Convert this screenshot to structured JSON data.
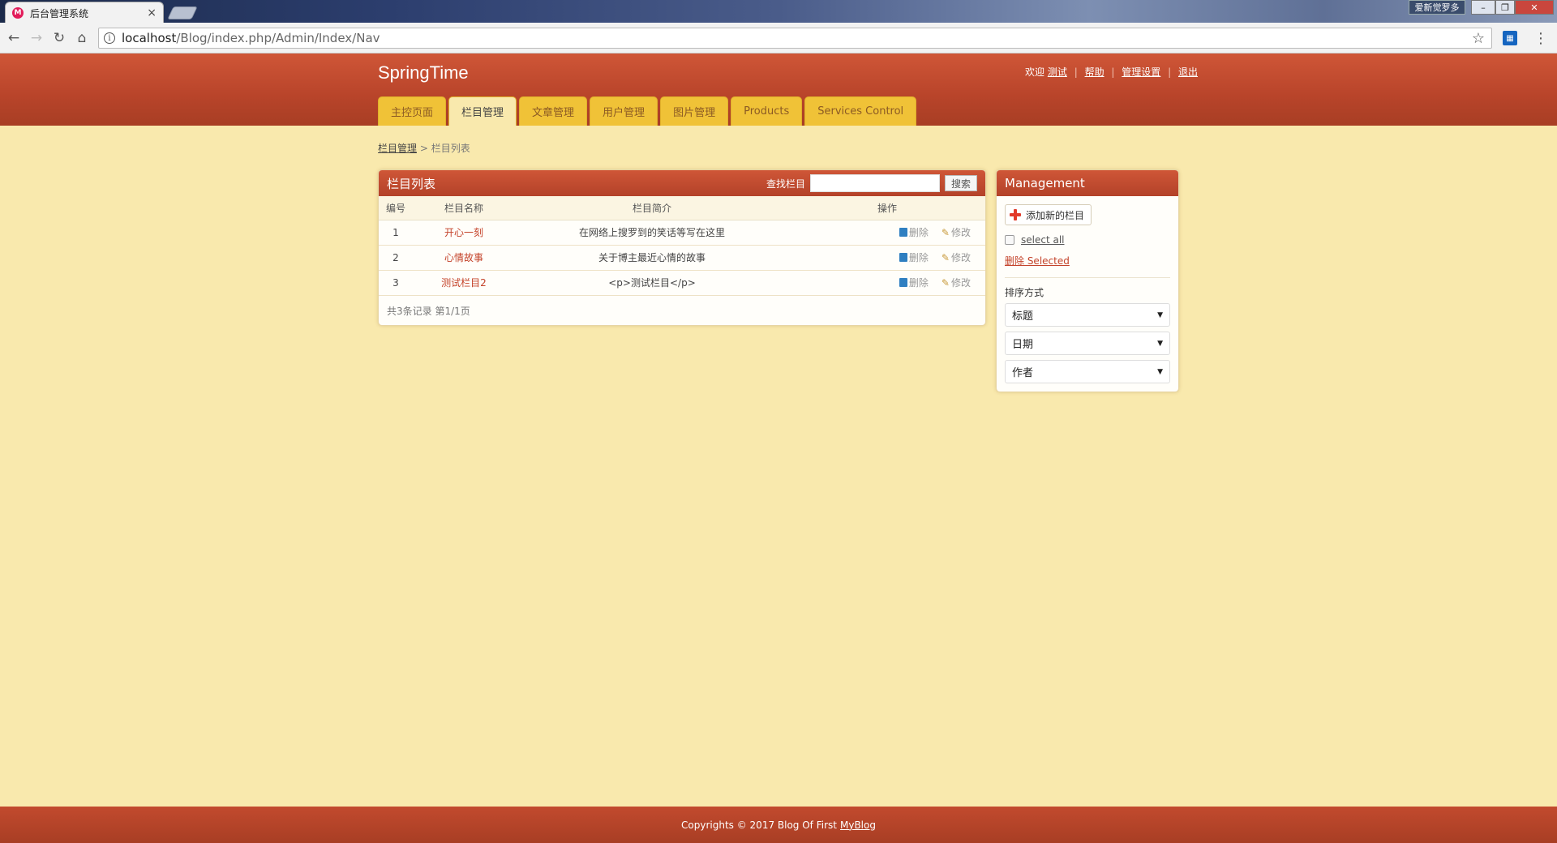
{
  "browser": {
    "tab_title": "后台管理系统",
    "tab_close": "×",
    "url_host": "localhost",
    "url_path": "/Blog/index.php/Admin/Index/Nav",
    "window_user": "爱新觉罗多",
    "info_glyph": "i"
  },
  "site": {
    "logo": "SpringTime",
    "user_nav": {
      "welcome": "欢迎",
      "username": "测试",
      "help": "帮助",
      "settings": "管理设置",
      "logout": "退出",
      "separator": "|"
    },
    "nav_tabs": [
      {
        "label": "主控页面"
      },
      {
        "label": "栏目管理"
      },
      {
        "label": "文章管理"
      },
      {
        "label": "用户管理"
      },
      {
        "label": "图片管理"
      },
      {
        "label": "Products"
      },
      {
        "label": "Services Control"
      }
    ],
    "active_tab": "栏目管理"
  },
  "breadcrumb": {
    "parent": "栏目管理",
    "separator": ">",
    "current": "栏目列表"
  },
  "list_panel": {
    "title": "栏目列表",
    "search_label": "查找栏目",
    "search_value": "",
    "search_button": "搜索",
    "columns": {
      "id": "编号",
      "name": "栏目名称",
      "intro": "栏目简介",
      "ops": "操作"
    },
    "rows": [
      {
        "id": "1",
        "name": "开心一刻",
        "intro": "在网络上搜罗到的笑话等写在这里",
        "delete": "删除",
        "edit": "修改"
      },
      {
        "id": "2",
        "name": "心情故事",
        "intro": "关于博主最近心情的故事",
        "delete": "删除",
        "edit": "修改"
      },
      {
        "id": "3",
        "name": "测试栏目2",
        "intro": "<p>测试栏目</p>",
        "delete": "删除",
        "edit": "修改"
      }
    ],
    "footer": "共3条记录 第1/1页"
  },
  "management": {
    "title": "Management",
    "add_button": "添加新的栏目",
    "select_all": "select all",
    "delete_selected": "删除 Selected",
    "sort_label": "排序方式",
    "sort_selects": [
      {
        "value": "标题"
      },
      {
        "value": "日期"
      },
      {
        "value": "作者"
      }
    ]
  },
  "footer": {
    "text": "Copyrights © 2017 Blog Of First",
    "link": "MyBlog"
  },
  "colors": {
    "page_bg": "#f9e9ad",
    "header_red": "#b8442a",
    "tab_yellow": "#f0c237",
    "link_red": "#c4432a"
  }
}
